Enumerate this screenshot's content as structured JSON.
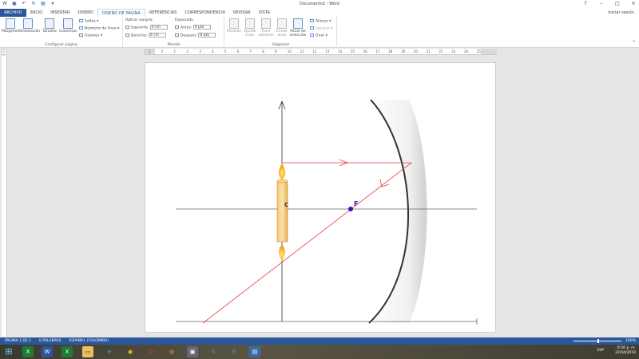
{
  "window": {
    "title": "Documento2 - Word",
    "controls": [
      "?",
      "–",
      "□",
      "×"
    ]
  },
  "tabs": [
    "ARCHIVO",
    "INICIO",
    "INSERTAR",
    "DISEÑO",
    "DISEÑO DE PÁGINA",
    "REFERENCIAS",
    "CORRESPONDENCIA",
    "REVISAR",
    "VISTA"
  ],
  "signin": "Iniciar sesión",
  "ribbon": {
    "config": {
      "margenes": "Márgenes",
      "orientacion": "Orientación",
      "tamano": "Tamaño",
      "columnas": "Columnas",
      "saltos": "Saltos",
      "numeros_linea": "Números de línea",
      "guiones": "Guiones",
      "label": "Configurar página"
    },
    "parrafo": {
      "aplicar_sangria": "Aplicar sangría",
      "izquierda": "Izquierda:",
      "izquierda_val": "0 cm",
      "derecha": "Derecha:",
      "derecha_val": "0 cm",
      "espaciado": "Espaciado",
      "antes": "Antes:",
      "antes_val": "0 pto",
      "despues": "Después:",
      "despues_val": "8 pto",
      "label": "Párrafo"
    },
    "organizar": {
      "posicion": "Posición",
      "ajustar": "Ajustar texto",
      "traer": "Traer adelante",
      "enviar": "Enviar atrás",
      "panel": "Panel de selección",
      "alinear": "Alinear",
      "agrupar": "Agrupar",
      "girar": "Girar",
      "label": "Organizar"
    }
  },
  "ruler": [
    "1",
    "2",
    "1",
    "2",
    "3",
    "4",
    "5",
    "6",
    "7",
    "8",
    "9",
    "10",
    "11",
    "12",
    "13",
    "14",
    "15",
    "16",
    "17",
    "18",
    "19",
    "20",
    "21",
    "22",
    "23",
    "24",
    "25"
  ],
  "diagram": {
    "focus_label": "F",
    "center_label": "C"
  },
  "status": {
    "page": "PÁGINA 1 DE 1",
    "words": "0 PALABRAS",
    "lang": "ESPAÑOL (COLOMBIA)",
    "zoom": "100%"
  },
  "tray": {
    "lang": "ESP",
    "time": "6:50 p. m.",
    "date": "22/04/2019"
  },
  "colors": {
    "word_blue": "#2b579a",
    "ray": "#e8393c",
    "focus": "#3a10c8"
  }
}
